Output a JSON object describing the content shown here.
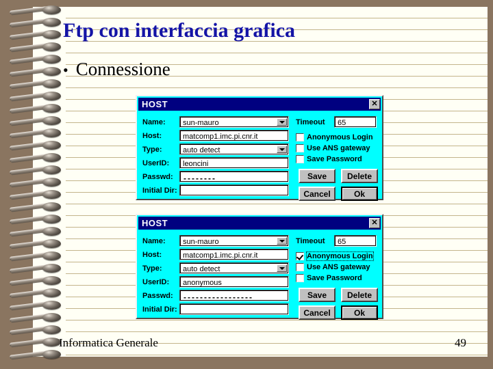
{
  "slide": {
    "title": "Ftp con interfaccia grafica",
    "bullet_glyph": "•",
    "bullet_text": "Connessione",
    "footer_left": "Informatica Generale",
    "footer_right": "49",
    "title_color": "#1414a6",
    "paper_color": "#fffff5",
    "background_color": "#8a7560",
    "rule_color": "#c3b48b"
  },
  "dialogs": [
    {
      "title": "HOST",
      "close_glyph": "✕",
      "dialog_bg": "#00ffff",
      "titlebar_color": "#000080",
      "fields": [
        {
          "label": "Name:",
          "value": "sun-mauro",
          "type": "combo"
        },
        {
          "label": "Host:",
          "value": "matcomp1.imc.pi.cnr.it",
          "type": "text"
        },
        {
          "label": "Type:",
          "value": "auto detect",
          "type": "combo"
        },
        {
          "label": "UserID:",
          "value": "leoncini",
          "type": "text"
        },
        {
          "label": "Passwd:",
          "value": "--------",
          "type": "password"
        },
        {
          "label": "Initial Dir:",
          "value": "",
          "type": "text"
        }
      ],
      "timeout": {
        "label": "Timeout",
        "value": "65"
      },
      "checkboxes": [
        {
          "label": "Anonymous Login",
          "checked": false,
          "focused": false
        },
        {
          "label": "Use ANS gateway",
          "checked": false,
          "focused": false
        },
        {
          "label": "Save Password",
          "checked": false,
          "focused": false
        }
      ],
      "buttons": [
        {
          "label": "Save",
          "default": false
        },
        {
          "label": "Delete",
          "default": false
        },
        {
          "label": "Cancel",
          "default": false
        },
        {
          "label": "Ok",
          "default": true
        }
      ]
    },
    {
      "title": "HOST",
      "close_glyph": "✕",
      "dialog_bg": "#00ffff",
      "titlebar_color": "#000080",
      "fields": [
        {
          "label": "Name:",
          "value": "sun-mauro",
          "type": "combo"
        },
        {
          "label": "Host:",
          "value": "matcomp1.imc.pi.cnr.it",
          "type": "text"
        },
        {
          "label": "Type:",
          "value": "auto detect",
          "type": "combo"
        },
        {
          "label": "UserID:",
          "value": "anonymous",
          "type": "text"
        },
        {
          "label": "Passwd:",
          "value": "-----------------",
          "type": "password"
        },
        {
          "label": "Initial Dir:",
          "value": "",
          "type": "text"
        }
      ],
      "timeout": {
        "label": "Timeout",
        "value": "65"
      },
      "checkboxes": [
        {
          "label": "Anonymous Login",
          "checked": true,
          "focused": true
        },
        {
          "label": "Use ANS gateway",
          "checked": false,
          "focused": false
        },
        {
          "label": "Save Password",
          "checked": false,
          "focused": false
        }
      ],
      "buttons": [
        {
          "label": "Save",
          "default": false
        },
        {
          "label": "Delete",
          "default": false
        },
        {
          "label": "Cancel",
          "default": false
        },
        {
          "label": "Ok",
          "default": true
        }
      ]
    }
  ]
}
